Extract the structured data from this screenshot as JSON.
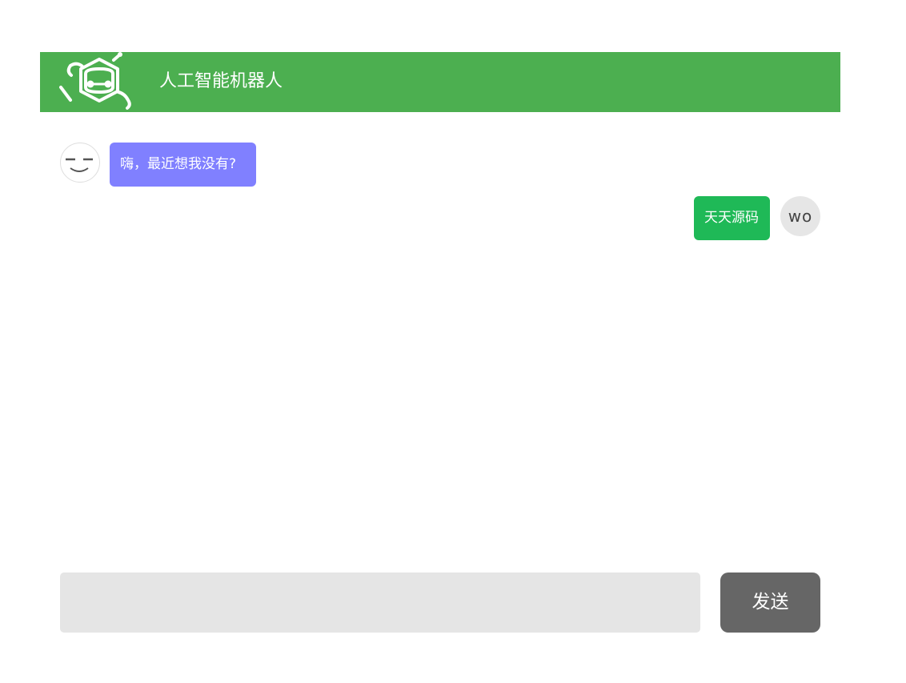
{
  "header": {
    "logo_icon": "robot-head-icon",
    "title": "人工智能机器人",
    "background_color": "#4caf50"
  },
  "messages": [
    {
      "sender": "bot",
      "avatar_icon": "sleepy-face-icon",
      "text": "嗨，最近想我没有?",
      "bubble_color": "#8080ff"
    },
    {
      "sender": "user",
      "avatar_text": "wo",
      "text": "天天源码",
      "bubble_color": "#1fb957"
    }
  ],
  "composer": {
    "input_value": "",
    "send_label": "发送",
    "send_color": "#666666"
  }
}
